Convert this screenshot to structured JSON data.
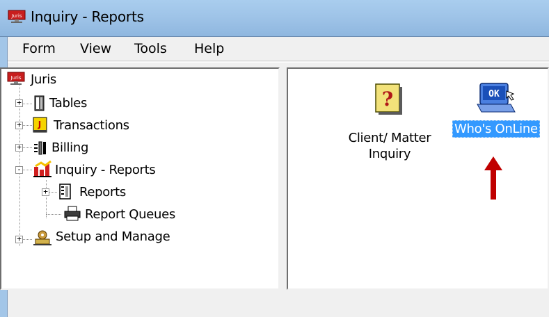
{
  "window": {
    "title": "Inquiry - Reports"
  },
  "menu": [
    "Form",
    "View",
    "Tools",
    "Help"
  ],
  "toolbar": {
    "buttons": [
      {
        "icon": "new-document-icon"
      },
      {
        "icon": "open-folder-icon"
      },
      {
        "icon": "save-icon"
      },
      {
        "icon": "up-folder-icon"
      },
      {
        "icon": "delete-icon"
      },
      {
        "icon": "large-icons-view-icon",
        "pressed": true
      },
      {
        "icon": "small-icons-view-icon"
      },
      {
        "icon": "list-view-icon"
      },
      {
        "icon": "details-view-icon"
      },
      {
        "icon": "globe-icon"
      }
    ]
  },
  "tree": {
    "root": "Juris",
    "items": [
      {
        "label": "Tables",
        "expander": "+"
      },
      {
        "label": "Transactions",
        "expander": "+"
      },
      {
        "label": "Billing",
        "expander": "+"
      },
      {
        "label": "Inquiry - Reports",
        "expander": "-"
      },
      {
        "label": "Reports",
        "expander": "+",
        "child": true
      },
      {
        "label": "Report Queues",
        "child": true
      },
      {
        "label": "Setup and Manage",
        "expander": "+"
      }
    ]
  },
  "list": {
    "items": [
      {
        "line1": "Client/ Matter",
        "line2": "Inquiry",
        "selected": false
      },
      {
        "line1": "Who's OnLine",
        "line2": "",
        "selected": true
      }
    ]
  },
  "colors": {
    "selection": "#3399ff",
    "arrow": "#c00000",
    "title_bar": "#9fc4e8"
  }
}
